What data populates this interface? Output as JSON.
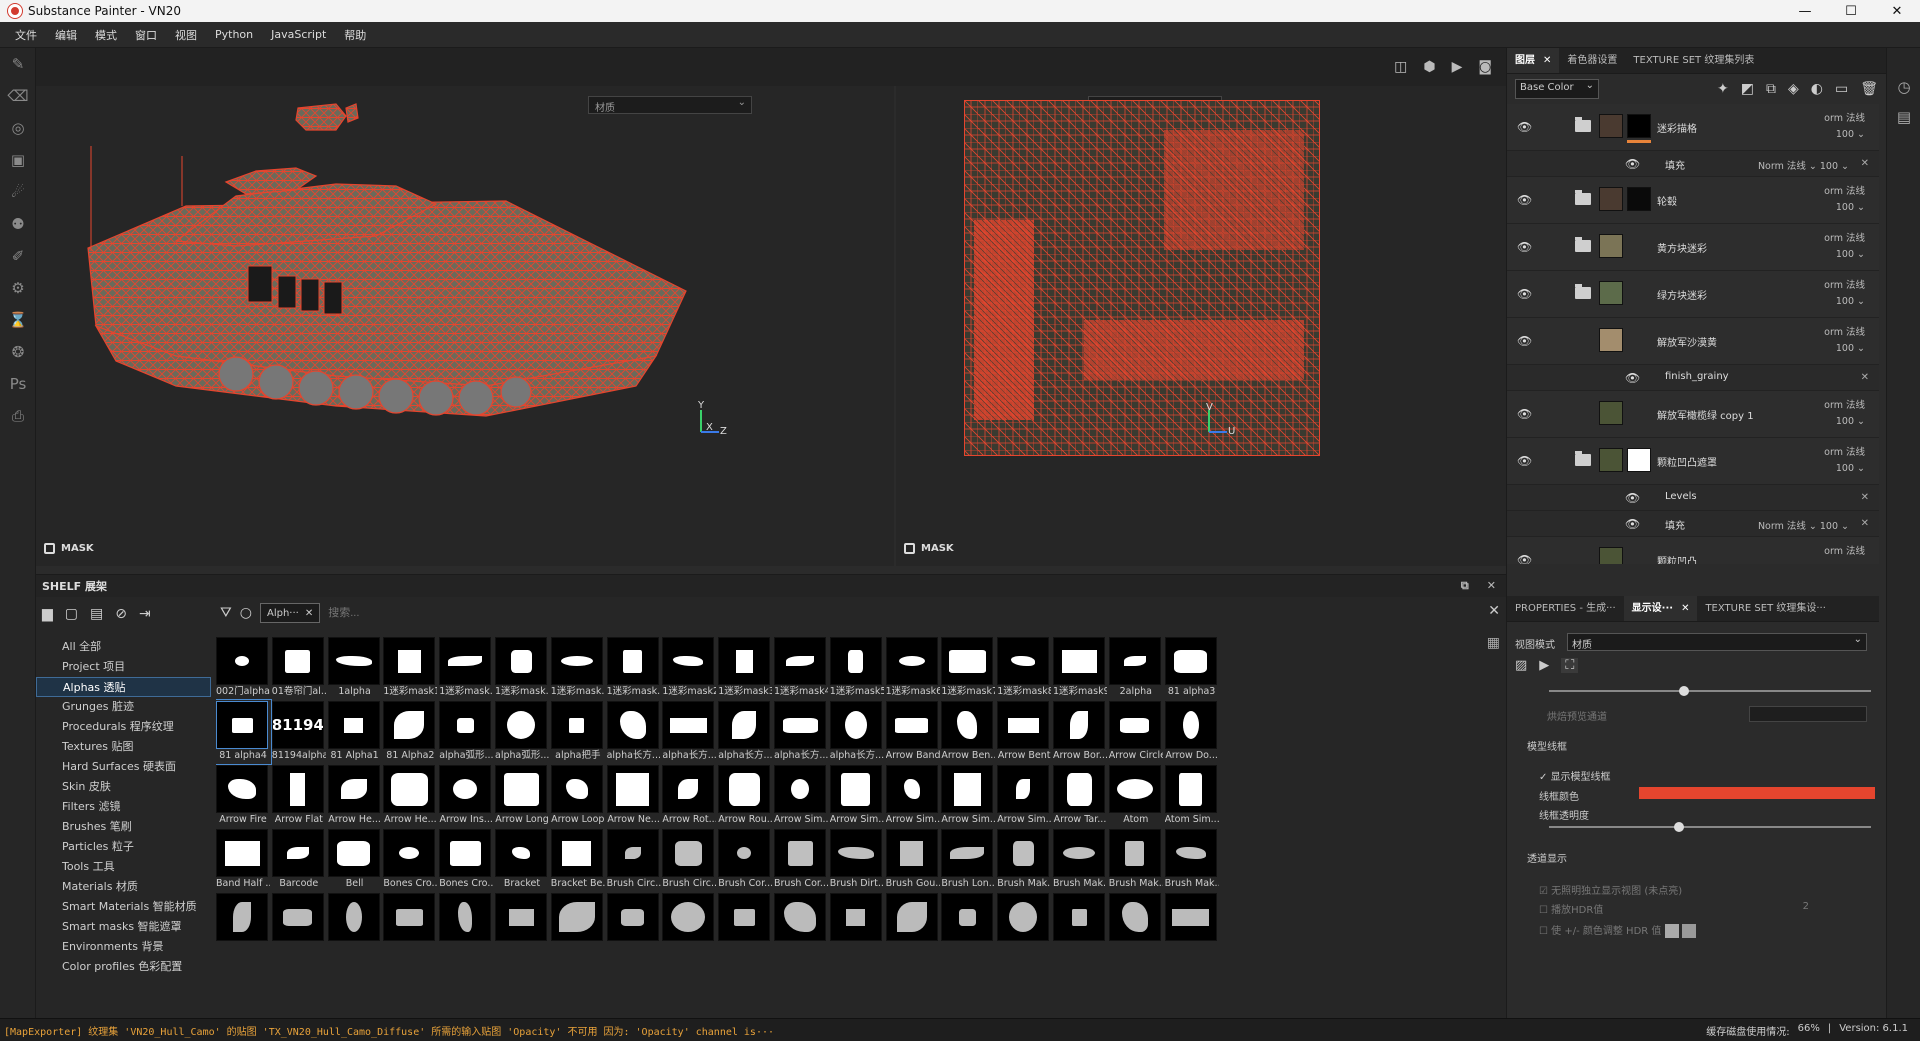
{
  "window": {
    "title": "Substance Painter - VN20",
    "controls": [
      "—",
      "☐",
      "✕"
    ]
  },
  "menu": [
    "文件",
    "编辑",
    "模式",
    "窗口",
    "视图",
    "Python",
    "JavaScript",
    "帮助"
  ],
  "viewport": {
    "material_select_left": "材质",
    "material_select_right": "材质",
    "mask_label_left": "MASK",
    "mask_label_right": "MASK",
    "axis_left": [
      "Y",
      "X",
      "Z"
    ],
    "axis_right": [
      "V",
      "U"
    ],
    "wire_color": "#e5452e"
  },
  "shelf": {
    "title": "SHELF 展架",
    "filter_chip": "Alph···",
    "search_placeholder": "搜索...",
    "categories": [
      "All 全部",
      "Project 项目",
      "Alphas 透贴",
      "Grunges 脏迹",
      "Procedurals 程序纹理",
      "Textures 贴图",
      "Hard Surfaces 硬表面",
      "Skin 皮肤",
      "Filters 滤镜",
      "Brushes 笔刷",
      "Particles 粒子",
      "Tools 工具",
      "Materials 材质",
      "Smart Materials 智能材质",
      "Smart masks 智能遮罩",
      "Environments 背景",
      "Color profiles 色彩配置"
    ],
    "selected_category": 2,
    "rows": [
      [
        "002门alpha",
        "01卷帘门al...",
        "1alpha",
        "1迷彩mask1",
        "1迷彩mask...",
        "1迷彩mask...",
        "1迷彩mask...",
        "1迷彩mask...",
        "1迷彩mask2",
        "1迷彩mask3",
        "1迷彩mask4",
        "1迷彩mask5",
        "1迷彩mask6",
        "1迷彩mask7",
        "1迷彩mask8",
        "1迷彩mask9",
        "2alpha",
        "81 alpha3"
      ],
      [
        "81 alpha4",
        "81194alpha",
        "81 Alpha1",
        "81 Alpha2",
        "alpha弧形...",
        "alpha弧形...",
        "alpha把手",
        "alpha长方...",
        "alpha长方...",
        "alpha长方...",
        "alpha长方...",
        "alpha长方...",
        "Arrow Band",
        "Arrow Ben...",
        "Arrow Bent",
        "Arrow Bor...",
        "Arrow Circle",
        "Arrow Do..."
      ],
      [
        "Arrow Fire",
        "Arrow Flat",
        "Arrow He...",
        "Arrow He...",
        "Arrow Ins...",
        "Arrow Long",
        "Arrow Loop",
        "Arrow Ne...",
        "Arrow Rot...",
        "Arrow Rou...",
        "Arrow Sim...",
        "Arrow Sim...",
        "Arrow Sim...",
        "Arrow Sim...",
        "Arrow Sim...",
        "Arrow Tar...",
        "Atom",
        "Atom Sim..."
      ],
      [
        "Band Half ...",
        "Barcode",
        "Bell",
        "Bones Cro...",
        "Bones Cro...",
        "Bracket",
        "Bracket Be...",
        "Brush Circ...",
        "Brush Circ...",
        "Brush Cor...",
        "Brush Cor...",
        "Brush Dirt...",
        "Brush Gou...",
        "Brush Lon...",
        "Brush Mak...",
        "Brush Mak...",
        "Brush Mak...",
        "Brush Mak..."
      ],
      [
        "",
        "",
        "",
        "",
        "",
        "",
        "",
        "",
        "",
        "",
        "",
        "",
        "",
        "",
        "",
        "",
        "",
        ""
      ]
    ],
    "selected_cell": [
      1,
      0
    ],
    "thumb_texts": {
      "r1c1": "81194"
    }
  },
  "status": {
    "message": "[MapExporter] 纹理集 'VN20_Hull_Camo' 的贴图 'TX_VN20_Hull_Camo_Diffuse' 所需的输入贴图 'Opacity' 不可用 因为: 'Opacity' channel is···",
    "cache": "缓存磁盘使用情况:",
    "cache_value": "66%",
    "version": "Version: 6.1.1"
  },
  "layers_panel": {
    "tabs": [
      {
        "label": "图层",
        "close": "✕"
      },
      {
        "label": "着色器设置",
        "close": ""
      },
      {
        "label": "TEXTURE SET 纹理集列表",
        "close": ""
      }
    ],
    "channel": "Base Color",
    "items": [
      {
        "kind": "layer",
        "name": "迷彩描格",
        "blend": "orm 法线",
        "opacity": "100 ⌄",
        "thumb": "#4a3a30",
        "mask": "#000000",
        "selected": true,
        "eye": true,
        "folder": true
      },
      {
        "kind": "sub",
        "name": "填充",
        "blend": "Norm 法线 ⌄ 100 ⌄",
        "x": "✕"
      },
      {
        "kind": "layer",
        "name": "轮毂",
        "blend": "orm 法线",
        "opacity": "100 ⌄",
        "thumb": "#4a3a30",
        "mask": "#0a0a0a",
        "eye": true,
        "folder": true
      },
      {
        "kind": "layer",
        "name": "黄方块迷彩",
        "blend": "orm 法线",
        "opacity": "100 ⌄",
        "thumb": "#7b7456",
        "mask": "",
        "eye": true,
        "folder": true
      },
      {
        "kind": "layer",
        "name": "绿方块迷彩",
        "blend": "orm 法线",
        "opacity": "100 ⌄",
        "thumb": "#5c6b4a",
        "mask": "",
        "eye": true,
        "folder": true
      },
      {
        "kind": "layer",
        "name": "解放军沙漠黄",
        "blend": "orm 法线",
        "opacity": "100 ⌄",
        "thumb": "#a38d6d",
        "mask": "",
        "eye": true,
        "folder": false
      },
      {
        "kind": "sub",
        "name": "finish_grainy",
        "blend": "",
        "x": "✕"
      },
      {
        "kind": "layer",
        "name": "解放军橄榄绿 copy 1",
        "blend": "orm 法线",
        "opacity": "100 ⌄",
        "thumb": "#4b5436",
        "mask": "",
        "eye": true,
        "folder": false
      },
      {
        "kind": "layer",
        "name": "颗粒凹凸遮罩",
        "blend": "orm 法线",
        "opacity": "100 ⌄",
        "thumb": "#4b5436",
        "mask": "#ffffff",
        "eye": true,
        "folder": true
      },
      {
        "kind": "sub",
        "name": "Levels",
        "blend": "",
        "x": "✕"
      },
      {
        "kind": "sub",
        "name": "填充",
        "blend": "Norm 法线 ⌄ 100 ⌄",
        "x": "✕"
      },
      {
        "kind": "layer",
        "name": "颗粒凹凸",
        "blend": "orm 法线",
        "opacity": "",
        "thumb": "#4b5436",
        "mask": "",
        "eye": true,
        "folder": false
      }
    ]
  },
  "props_panel": {
    "tabs": [
      {
        "label": "PROPERTIES - 生成···",
        "close": ""
      },
      {
        "label": "显示设···",
        "close": "✕"
      },
      {
        "label": "TEXTURE SET 纹理集设···",
        "close": ""
      }
    ],
    "view_mode_label": "视图模式",
    "view_mode_value": "材质",
    "bake_label": "烘焙预览通道",
    "wire_section": "模型线框",
    "show_wire": "显示模型线框",
    "wire_color_label": "线框颜色",
    "wire_color": "#e5452e",
    "wire_opacity_label": "线框透明度",
    "wire_opacity": 0.4,
    "alpha_section": "透道显示",
    "alpha_opt1": "无照明独立显示视图 (未点亮)",
    "alpha_opt2": "播放HDR值",
    "alpha_opt3": "使 +/- 颜色调整 HDR 值",
    "hdr_value": "2"
  }
}
